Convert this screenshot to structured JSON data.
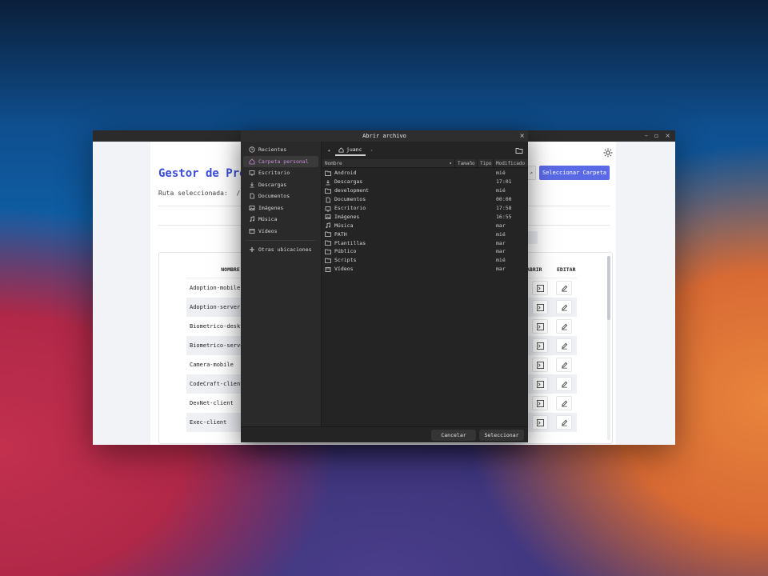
{
  "app_window": {
    "controls": [
      "–",
      "▫",
      "×"
    ],
    "title": "Gestor de Pro",
    "path_label": "Ruta seleccionada:",
    "path_value": "/hom",
    "select_folder_label": "Seleccionar Carpeta",
    "table": {
      "col_name": "NOMBRE",
      "col_open": "ABRIR",
      "col_edit": "EDITAR",
      "rows": [
        "Adoption-mobile",
        "Adoption-server",
        "Biometrico-deskto",
        "Biometrico-server",
        "Camera-mobile",
        "CodeCraft-client",
        "DevNet-client",
        "Exec-client"
      ]
    }
  },
  "dialog": {
    "title": "Abrir archivo",
    "close": "×",
    "places": [
      {
        "label": "Recientes",
        "icon": "clock-icon"
      },
      {
        "label": "Carpeta personal",
        "icon": "home-icon",
        "active": true
      },
      {
        "label": "Escritorio",
        "icon": "desktop-icon"
      },
      {
        "label": "Descargas",
        "icon": "download-icon"
      },
      {
        "label": "Documentos",
        "icon": "document-icon"
      },
      {
        "label": "Imágenes",
        "icon": "image-icon"
      },
      {
        "label": "Música",
        "icon": "music-icon"
      },
      {
        "label": "Vídeos",
        "icon": "video-icon"
      }
    ],
    "other_locations": "Otras ubicaciones",
    "crumb": "juanc",
    "columns": {
      "name": "Nombre",
      "size": "Tamaño",
      "type": "Tipo",
      "modified": "Modificado"
    },
    "files": [
      {
        "name": "Android",
        "mod": "mié",
        "icon": "folder-icon"
      },
      {
        "name": "Descargas",
        "mod": "17:01",
        "icon": "download-icon"
      },
      {
        "name": "development",
        "mod": "mié",
        "icon": "folder-icon"
      },
      {
        "name": "Documentos",
        "mod": "00:00",
        "icon": "document-icon"
      },
      {
        "name": "Escritorio",
        "mod": "17:58",
        "icon": "desktop-icon"
      },
      {
        "name": "Imágenes",
        "mod": "16:55",
        "icon": "image-icon"
      },
      {
        "name": "Música",
        "mod": "mar",
        "icon": "music-icon"
      },
      {
        "name": "PATH",
        "mod": "mié",
        "icon": "folder-icon"
      },
      {
        "name": "Plantillas",
        "mod": "mar",
        "icon": "folder-icon"
      },
      {
        "name": "Público",
        "mod": "mar",
        "icon": "folder-icon"
      },
      {
        "name": "Scripts",
        "mod": "mié",
        "icon": "folder-icon"
      },
      {
        "name": "Vídeos",
        "mod": "mar",
        "icon": "video-icon"
      }
    ],
    "cancel_label": "Cancelar",
    "select_label": "Seleccionar"
  }
}
